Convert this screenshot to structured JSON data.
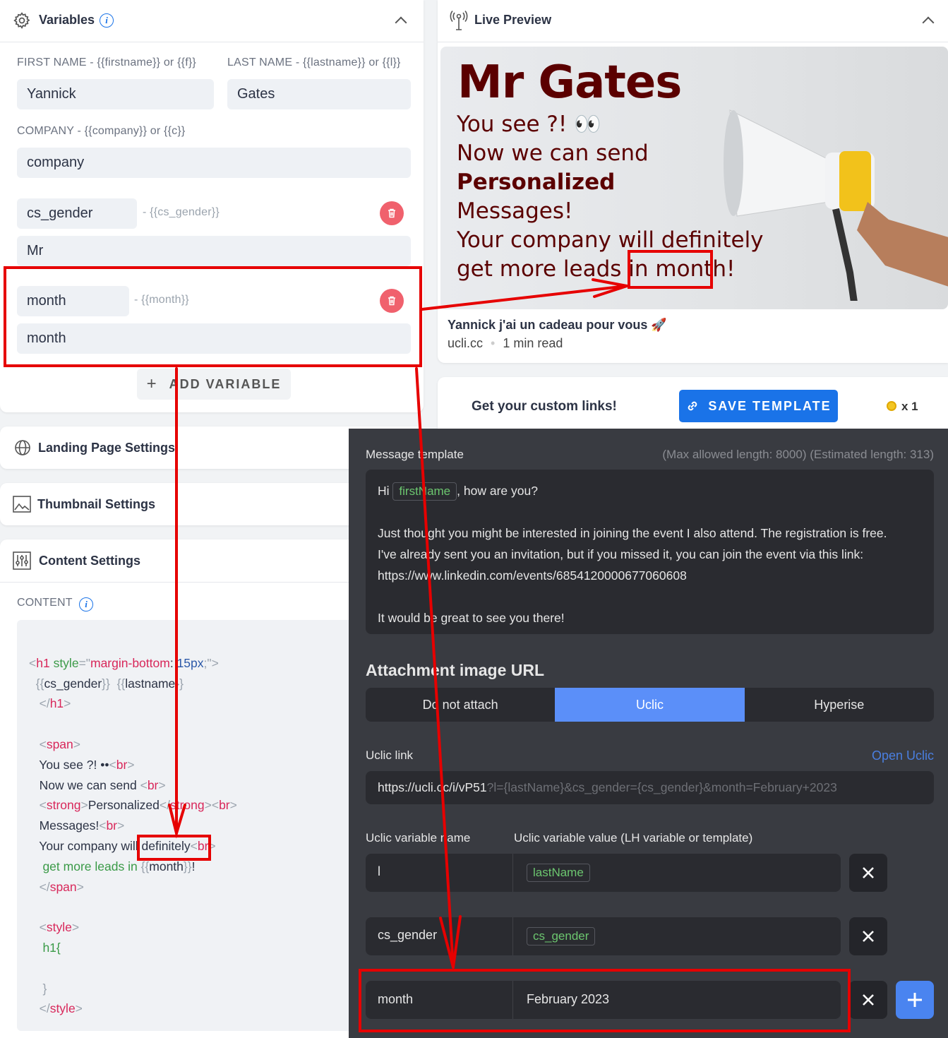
{
  "variables": {
    "title": "Variables",
    "first_name_label": "FIRST NAME - {{firstname}} or {{f}}",
    "first_name_value": "Yannick",
    "last_name_label": "LAST NAME - {{lastname}} or {{l}}",
    "last_name_value": "Gates",
    "company_label": "COMPANY - {{company}} or {{c}}",
    "company_value": "company",
    "custom": [
      {
        "name": "cs_gender",
        "token": "- {{cs_gender}}",
        "value": "Mr"
      },
      {
        "name": "month",
        "token": "- {{month}}",
        "value": "month"
      }
    ],
    "add_label": "ADD VARIABLE",
    "add_icon": "+"
  },
  "sections": {
    "landing": "Landing Page Settings",
    "thumbnail": "Thumbnail Settings",
    "content": "Content Settings",
    "content_label": "CONTENT"
  },
  "code": {
    "l1_open": "<",
    "l1_tag": "h1",
    "l1_attr": " style",
    "l1_eq": "=\"",
    "l1_val": "margin-bottom",
    "l1_colon": ": ",
    "l1_num": "15px",
    "l1_end": ";\">",
    "l2_a": "{{",
    "l2_b": "cs_gender",
    "l2_c": "}}  {{",
    "l2_d": "lastname",
    "l2_e": "}}",
    "l3_a": "</",
    "l3_b": "h1",
    "l3_c": ">",
    "span_open_a": "<",
    "span_open_b": "span",
    "span_open_c": ">",
    "youseee": "You see ?! ",
    "eyes": "••",
    "br": "br",
    "nowsend": "Now we can send ",
    "strong": "strong",
    "personalized": "Personalized",
    "strong_close": "</",
    "messages": "Messages!",
    "yourcompany": "Your company will definitely",
    "getmore": "get more leads in ",
    "month_a": "{{",
    "month_b": "month",
    "month_c": "}}",
    "month_d": "!",
    "style": "style",
    "h1brace": "h1{",
    "close_brace": "}"
  },
  "preview": {
    "title": "Live Preview",
    "heading": "Mr Gates",
    "line1": "You see ?! 👀",
    "line2": "Now we can send",
    "line3": "Personalized",
    "line4": "Messages!",
    "line5": "Your company will definitely",
    "line6a": "get more leads in ",
    "line6b": "month!",
    "card_title": "Yannick j'ai un cadeau pour vous 🚀",
    "domain": "ucli.cc",
    "read": "1 min read"
  },
  "save_bar": {
    "text": "Get your custom links!",
    "button": "SAVE TEMPLATE",
    "credits": "x 1"
  },
  "message": {
    "label": "Message template",
    "limits": "(Max allowed length: 8000) (Estimated length: 313)",
    "hi": "Hi",
    "firstname_chip": "firstName",
    "how": ", how are you?",
    "p1": "Just thought you might be interested in joining the event I also attend. The registration is free.",
    "p2": "I've already sent you an invitation, but if you missed it, you can join the event via this link:",
    "p3": "https://www.linkedin.com/events/6854120000677060608",
    "p4": "It would be great to see you there!"
  },
  "attachment": {
    "title": "Attachment image URL",
    "options": [
      "Do not attach",
      "Uclic",
      "Hyperise"
    ],
    "selected": "Uclic"
  },
  "uclic": {
    "link_label": "Uclic link",
    "open": "Open Uclic",
    "link_main": "https://ucli.cc/i/vP51",
    "link_query": "?l={lastName}&cs_gender={cs_gender}&month=February+2023",
    "name_header": "Uclic variable name",
    "value_header": "Uclic variable value (LH variable or template)",
    "rows": [
      {
        "name": "l",
        "value": "lastName"
      },
      {
        "name": "cs_gender",
        "value": "cs_gender"
      },
      {
        "name": "month",
        "value": "February 2023"
      }
    ]
  },
  "colors": {
    "accent": "#1a73e8",
    "danger": "#f0616d",
    "annotation": "#e60000",
    "uclic_selected": "#5b8ff9"
  }
}
